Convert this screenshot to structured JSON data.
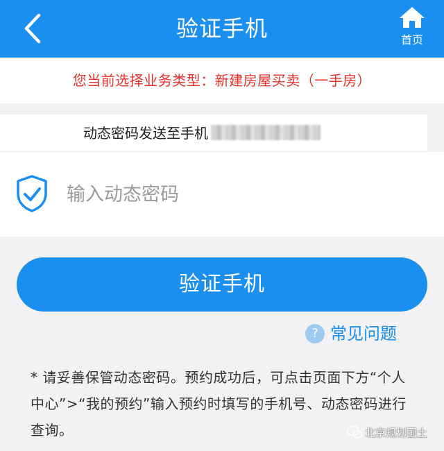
{
  "header": {
    "title": "验证手机",
    "back_icon": "chevron-left-icon",
    "home_icon": "home-icon",
    "home_label": "首页",
    "color": "#1b8ff0"
  },
  "notice": {
    "text": "您当前选择业务类型：新建房屋买卖（一手房）",
    "color": "#e8322b"
  },
  "sent_to": {
    "label": "动态密码发送至手机"
  },
  "code_field": {
    "icon": "shield-check-icon",
    "placeholder": "输入动态密码",
    "value": ""
  },
  "verify_button": {
    "label": "验证手机"
  },
  "faq": {
    "icon": "question-circle-icon",
    "icon_glyph": "?",
    "label": "常见问题"
  },
  "note": {
    "text": "* 请妥善保管动态密码。预约成功后，可点击页面下方“个人中心”>“我的预约”输入预约时填写的手机号、动态密码进行查询。"
  },
  "watermark": {
    "text": "北京规划国土",
    "icon": "wechat-icon"
  }
}
